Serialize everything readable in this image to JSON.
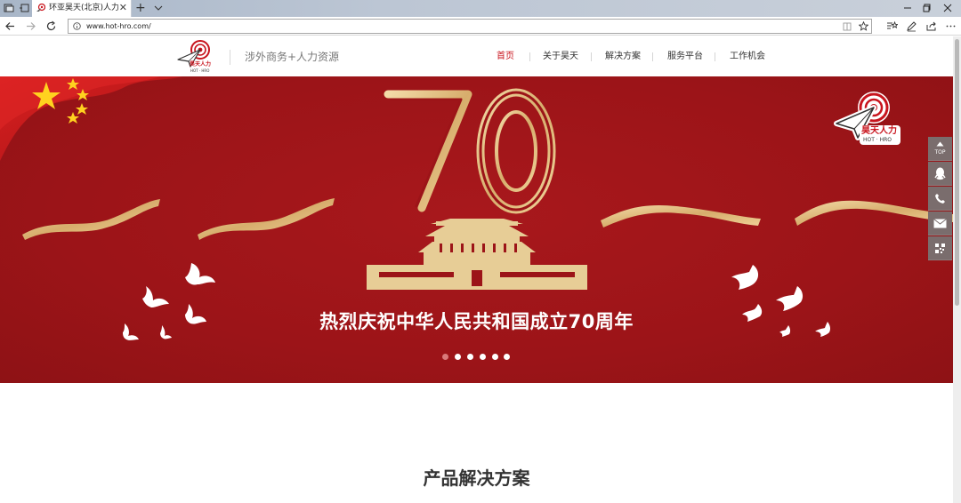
{
  "browser": {
    "tab_title": "环亚昊天(北京)人力资源",
    "url": "www.hot-hro.com/"
  },
  "site": {
    "tagline": "涉外商务+人力资源",
    "nav": [
      {
        "label": "首页",
        "active": true
      },
      {
        "label": "关于昊天",
        "active": false
      },
      {
        "label": "解决方案",
        "active": false
      },
      {
        "label": "服务平台",
        "active": false
      },
      {
        "label": "工作机会",
        "active": false
      }
    ],
    "logo_text": "昊天人力",
    "logo_sub": "HOT · HRO"
  },
  "banner": {
    "number": "70",
    "slogan": "热烈庆祝中华人民共和国成立70周年",
    "slide_count": 6,
    "active_slide": 0,
    "colors": {
      "background": "#9c1418",
      "gold": "#e2c28a"
    }
  },
  "float_bar": {
    "top_label": "TOP",
    "items": [
      "top",
      "qq",
      "phone",
      "mail",
      "qrcode"
    ]
  },
  "section": {
    "title": "产品解决方案"
  },
  "colors": {
    "accent": "#c8141d",
    "float_bar": "#7a6d6d"
  }
}
